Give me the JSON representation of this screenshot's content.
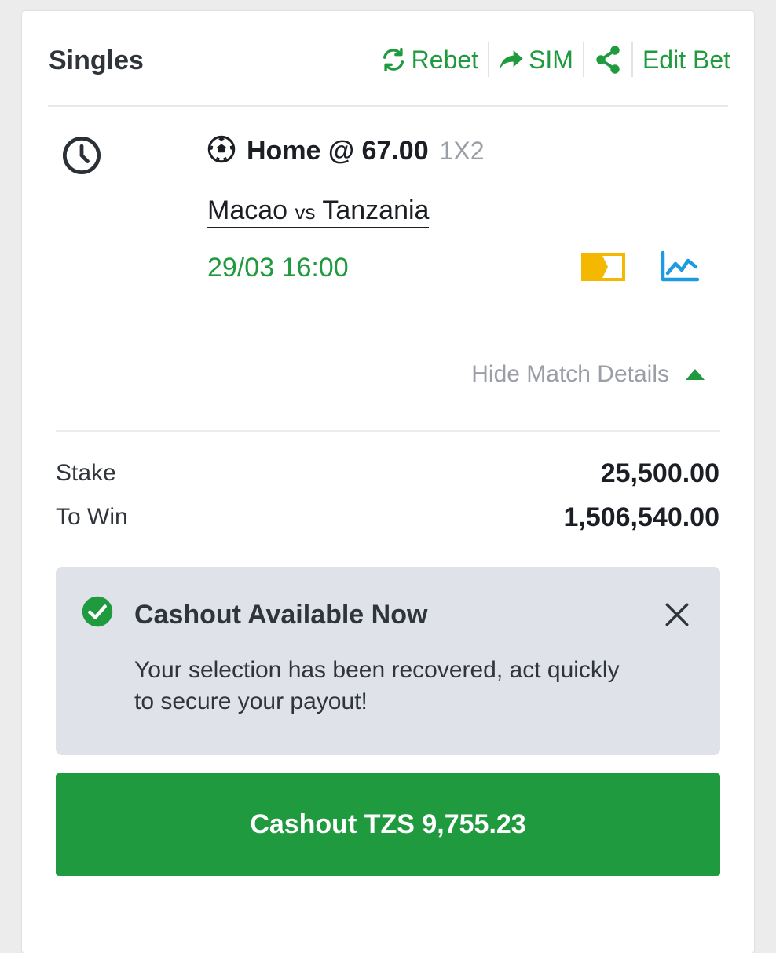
{
  "header": {
    "title": "Singles",
    "actions": {
      "rebet": "Rebet",
      "sim": "SIM",
      "share_icon": "share-icon",
      "edit_bet": "Edit Bet"
    }
  },
  "selection": {
    "pick": "Home @",
    "odds": "67.00",
    "market": "1X2",
    "match": {
      "home": "Macao",
      "vs": "vs",
      "away": "Tanzania"
    },
    "datetime": "29/03 16:00",
    "toggle_details": "Hide Match Details"
  },
  "summary": {
    "stake_label": "Stake",
    "stake_value": "25,500.00",
    "to_win_label": "To Win",
    "to_win_value": "1,506,540.00"
  },
  "notice": {
    "title": "Cashout Available Now",
    "body": "Your selection has been recovered, act quickly to secure your payout!"
  },
  "cashout_button": "Cashout TZS 9,755.23",
  "colors": {
    "brand_green": "#1f9a3f",
    "notice_bg": "#dfe2e8",
    "tv_yellow": "#f5b800",
    "stats_blue": "#1e9be0"
  },
  "icons": [
    "refresh-icon",
    "forward-arrow-icon",
    "share-icon",
    "clock-icon",
    "soccer-ball-icon",
    "live-tv-icon",
    "stats-chart-icon",
    "caret-up-icon",
    "check-circle-icon",
    "close-icon"
  ]
}
